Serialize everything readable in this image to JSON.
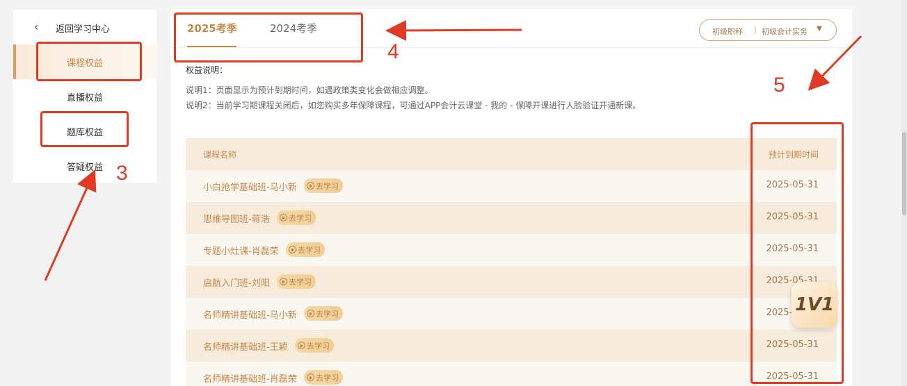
{
  "sidebar": {
    "back_label": "返回学习中心",
    "items": [
      {
        "label": "课程权益",
        "active": true
      },
      {
        "label": "直播权益",
        "active": false
      },
      {
        "label": "题库权益",
        "active": false
      },
      {
        "label": "答疑权益",
        "active": false
      }
    ]
  },
  "tabs": [
    {
      "label": "2025考季",
      "active": true
    },
    {
      "label": "2024考季",
      "active": false
    }
  ],
  "filter": {
    "level": "初级职称",
    "separator": "|",
    "subject": "初级会计实务"
  },
  "explain": {
    "title": "权益说明：",
    "line1": "说明1：页面显示为预计到期时间，如遇政策类变化会做相应调整。",
    "line2": "说明2：当前学习期课程关闭后，如您购买多年保障课程，可通过APP会计云课堂 - 我的 - 保障开课进行人脸验证开通新课。"
  },
  "table": {
    "headers": {
      "name": "课程名称",
      "date": "预计到期时间"
    },
    "go_label": "去学习",
    "rows": [
      {
        "name": "小白抢学基础班-马小新",
        "date": "2025-05-31"
      },
      {
        "name": "思维导图班-蒋浩",
        "date": "2025-05-31"
      },
      {
        "name": "专题小灶课-肖磊荣",
        "date": "2025-05-31"
      },
      {
        "name": "启航入门班-刘阳",
        "date": "2025-05-31"
      },
      {
        "name": "名师精讲基础班-马小新",
        "date": "2025-05-31"
      },
      {
        "name": "名师精讲基础班-王颖",
        "date": "2025-05-31"
      },
      {
        "name": "名师精讲基础班-肖磊荣",
        "date": "2025-05-31"
      }
    ]
  },
  "badge": {
    "label": "1V1"
  },
  "annotations": {
    "n3": "3",
    "n4": "4",
    "n5": "5",
    "color": "#e03a24"
  },
  "colors": {
    "accent": "#c5884a",
    "header_bg": "#f7ebdb",
    "row_bg": "#faf6f0"
  }
}
